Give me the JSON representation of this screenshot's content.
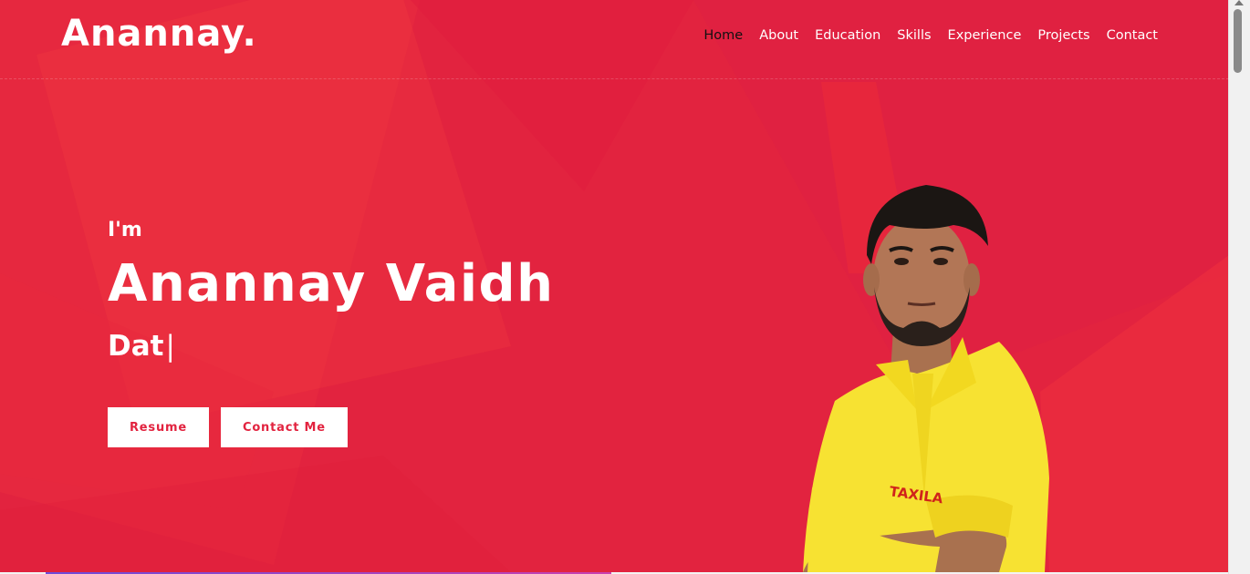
{
  "header": {
    "logo": "Anannay.",
    "nav": [
      {
        "label": "Home",
        "active": true
      },
      {
        "label": "About"
      },
      {
        "label": "Education"
      },
      {
        "label": "Skills"
      },
      {
        "label": "Experience"
      },
      {
        "label": "Projects"
      },
      {
        "label": "Contact"
      }
    ]
  },
  "hero": {
    "greeting": "I'm",
    "name": "Anannay Vaidh",
    "typed_text": "Dat",
    "cursor": "|",
    "buttons": {
      "resume": "Resume",
      "contact": "Contact Me"
    },
    "portrait_shirt_text": "TAXILA"
  },
  "colors": {
    "accent": "#e2233f",
    "shirt": "#f7e232",
    "active_nav": "#111111"
  },
  "icons": {
    "scroll_up": "scroll-up-arrow-icon"
  }
}
